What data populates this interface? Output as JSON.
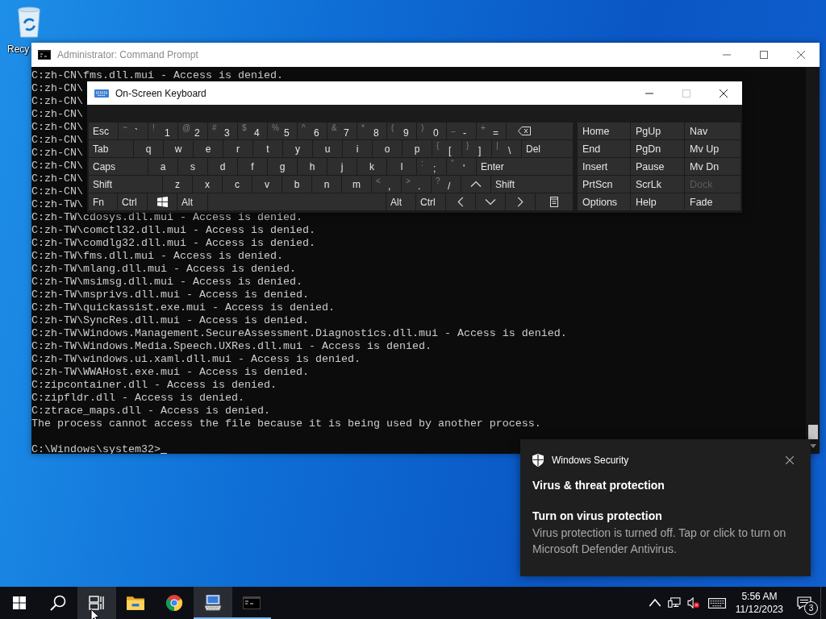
{
  "desktop": {
    "icons": [
      {
        "label": "Recy"
      }
    ]
  },
  "command_prompt": {
    "title": "Administrator: Command Prompt",
    "lines": [
      "C:zh-CN\\fms.dll.mui - Access is denied.",
      "C:zh-CN\\",
      "C:zh-CN\\",
      "C:zh-CN\\",
      "C:zh-CN\\",
      "C:zh-CN\\",
      "C:zh-CN\\",
      "C:zh-CN\\",
      "C:zh-CN\\",
      "C:zh-CN\\",
      "C:zh-TW\\",
      "C:zh-TW\\cdosys.dll.mui - Access is denied.",
      "C:zh-TW\\comctl32.dll.mui - Access is denied.",
      "C:zh-TW\\comdlg32.dll.mui - Access is denied.",
      "C:zh-TW\\fms.dll.mui - Access is denied.",
      "C:zh-TW\\mlang.dll.mui - Access is denied.",
      "C:zh-TW\\msimsg.dll.mui - Access is denied.",
      "C:zh-TW\\msprivs.dll.mui - Access is denied.",
      "C:zh-TW\\quickassist.exe.mui - Access is denied.",
      "C:zh-TW\\SyncRes.dll.mui - Access is denied.",
      "C:zh-TW\\Windows.Management.SecureAssessment.Diagnostics.dll.mui - Access is denied.",
      "C:zh-TW\\Windows.Media.Speech.UXRes.dll.mui - Access is denied.",
      "C:zh-TW\\windows.ui.xaml.dll.mui - Access is denied.",
      "C:zh-TW\\WWAHost.exe.mui - Access is denied.",
      "C:zipcontainer.dll - Access is denied.",
      "C:zipfldr.dll - Access is denied.",
      "C:ztrace_maps.dll - Access is denied.",
      "The process cannot access the file because it is being used by another process."
    ],
    "prompt": "C:\\Windows\\system32>"
  },
  "on_screen_keyboard": {
    "title": "On-Screen Keyboard",
    "maximize_disabled": true,
    "main_keys": [
      [
        {
          "kind": "text",
          "label": "Esc"
        },
        {
          "kind": "dual",
          "shift": "~",
          "label": "`"
        },
        {
          "kind": "dual",
          "shift": "!",
          "label": "1"
        },
        {
          "kind": "dual",
          "shift": "@",
          "label": "2"
        },
        {
          "kind": "dual",
          "shift": "#",
          "label": "3"
        },
        {
          "kind": "dual",
          "shift": "$",
          "label": "4"
        },
        {
          "kind": "dual",
          "shift": "%",
          "label": "5"
        },
        {
          "kind": "dual",
          "shift": "^",
          "label": "6"
        },
        {
          "kind": "dual",
          "shift": "&",
          "label": "7"
        },
        {
          "kind": "dual",
          "shift": "*",
          "label": "8"
        },
        {
          "kind": "dual",
          "shift": "(",
          "label": "9"
        },
        {
          "kind": "dual",
          "shift": ")",
          "label": "0"
        },
        {
          "kind": "dual",
          "shift": "_",
          "label": "-"
        },
        {
          "kind": "dual",
          "shift": "+",
          "label": "="
        },
        {
          "kind": "backspace"
        }
      ],
      [
        {
          "kind": "text",
          "label": "Tab"
        },
        {
          "kind": "letter",
          "label": "q"
        },
        {
          "kind": "letter",
          "label": "w"
        },
        {
          "kind": "letter",
          "label": "e"
        },
        {
          "kind": "letter",
          "label": "r"
        },
        {
          "kind": "letter",
          "label": "t"
        },
        {
          "kind": "letter",
          "label": "y"
        },
        {
          "kind": "letter",
          "label": "u"
        },
        {
          "kind": "letter",
          "label": "i"
        },
        {
          "kind": "letter",
          "label": "o"
        },
        {
          "kind": "letter",
          "label": "p"
        },
        {
          "kind": "dual",
          "shift": "{",
          "label": "["
        },
        {
          "kind": "dual",
          "shift": "}",
          "label": "]"
        },
        {
          "kind": "dual",
          "shift": "|",
          "label": "\\"
        },
        {
          "kind": "text",
          "label": "Del"
        }
      ],
      [
        {
          "kind": "text",
          "label": "Caps"
        },
        {
          "kind": "letter",
          "label": "a"
        },
        {
          "kind": "letter",
          "label": "s"
        },
        {
          "kind": "letter",
          "label": "d"
        },
        {
          "kind": "letter",
          "label": "f"
        },
        {
          "kind": "letter",
          "label": "g"
        },
        {
          "kind": "letter",
          "label": "h"
        },
        {
          "kind": "letter",
          "label": "j"
        },
        {
          "kind": "letter",
          "label": "k"
        },
        {
          "kind": "letter",
          "label": "l"
        },
        {
          "kind": "dual",
          "shift": ":",
          "label": ";"
        },
        {
          "kind": "dual",
          "shift": "\"",
          "label": "'"
        },
        {
          "kind": "text",
          "label": "Enter"
        }
      ],
      [
        {
          "kind": "text",
          "label": "Shift"
        },
        {
          "kind": "letter",
          "label": "z"
        },
        {
          "kind": "letter",
          "label": "x"
        },
        {
          "kind": "letter",
          "label": "c"
        },
        {
          "kind": "letter",
          "label": "v"
        },
        {
          "kind": "letter",
          "label": "b"
        },
        {
          "kind": "letter",
          "label": "n"
        },
        {
          "kind": "letter",
          "label": "m"
        },
        {
          "kind": "dual",
          "shift": "<",
          "label": ","
        },
        {
          "kind": "dual",
          "shift": ">",
          "label": "."
        },
        {
          "kind": "dual",
          "shift": "?",
          "label": "/"
        },
        {
          "kind": "up"
        },
        {
          "kind": "text",
          "label": "Shift"
        }
      ],
      [
        {
          "kind": "text",
          "label": "Fn"
        },
        {
          "kind": "text",
          "label": "Ctrl"
        },
        {
          "kind": "windows"
        },
        {
          "kind": "text",
          "label": "Alt"
        },
        {
          "kind": "space"
        },
        {
          "kind": "text",
          "label": "Alt"
        },
        {
          "kind": "text",
          "label": "Ctrl"
        },
        {
          "kind": "left"
        },
        {
          "kind": "down"
        },
        {
          "kind": "right"
        },
        {
          "kind": "menu"
        }
      ]
    ],
    "nav_keys": [
      [
        {
          "label": "Home",
          "disabled": false
        },
        {
          "label": "PgUp",
          "disabled": false
        },
        {
          "label": "Nav",
          "disabled": false
        }
      ],
      [
        {
          "label": "End",
          "disabled": false
        },
        {
          "label": "PgDn",
          "disabled": false
        },
        {
          "label": "Mv Up",
          "disabled": false
        }
      ],
      [
        {
          "label": "Insert",
          "disabled": false
        },
        {
          "label": "Pause",
          "disabled": false
        },
        {
          "label": "Mv Dn",
          "disabled": false
        }
      ],
      [
        {
          "label": "PrtScn",
          "disabled": false
        },
        {
          "label": "ScrLk",
          "disabled": false
        },
        {
          "label": "Dock",
          "disabled": true
        }
      ],
      [
        {
          "label": "Options",
          "disabled": false
        },
        {
          "label": "Help",
          "disabled": false
        },
        {
          "label": "Fade",
          "disabled": false
        }
      ]
    ]
  },
  "notification": {
    "app": "Windows Security",
    "title": "Virus & threat protection",
    "heading": "Turn on virus protection",
    "body": "Virus protection is turned off. Tap or click to turn on Microsoft Defender Antivirus."
  },
  "taskbar": {
    "items": [
      {
        "kind": "start",
        "running": false,
        "highlighted": false
      },
      {
        "kind": "search",
        "running": false,
        "highlighted": false
      },
      {
        "kind": "task-view",
        "running": false,
        "highlighted": true
      },
      {
        "kind": "folder",
        "running": false,
        "highlighted": false
      },
      {
        "kind": "browser",
        "running": false,
        "highlighted": false
      },
      {
        "kind": "keyboard",
        "running": true,
        "highlighted": true
      },
      {
        "kind": "terminal",
        "running": true,
        "highlighted": false
      }
    ],
    "time": "5:56 AM",
    "date": "11/12/2023",
    "notification_count": "3"
  }
}
